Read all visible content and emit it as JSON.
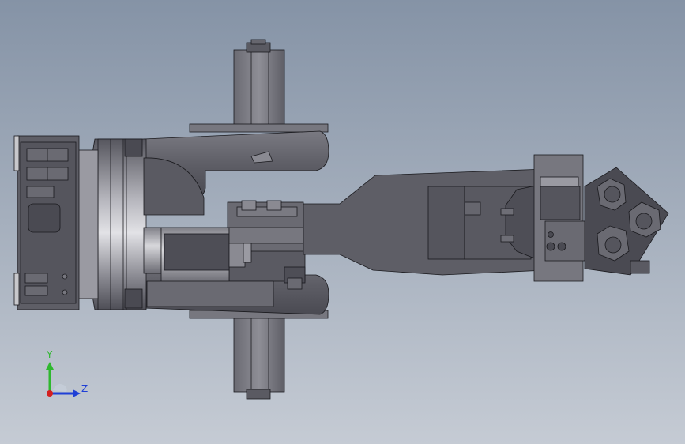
{
  "viewport": {
    "background_top": "#8593a6",
    "background_bottom": "#c3c9d2",
    "model_color_dark": "#4a4a52",
    "model_color_mid": "#6d6d76",
    "model_color_light": "#9a9aa2",
    "edge_color": "#1a1a1e"
  },
  "triad": {
    "y_label": "Y",
    "z_label": "Z",
    "y_color": "#2eb82e",
    "z_color": "#1f3fd6",
    "origin_color": "#d41f1f"
  }
}
